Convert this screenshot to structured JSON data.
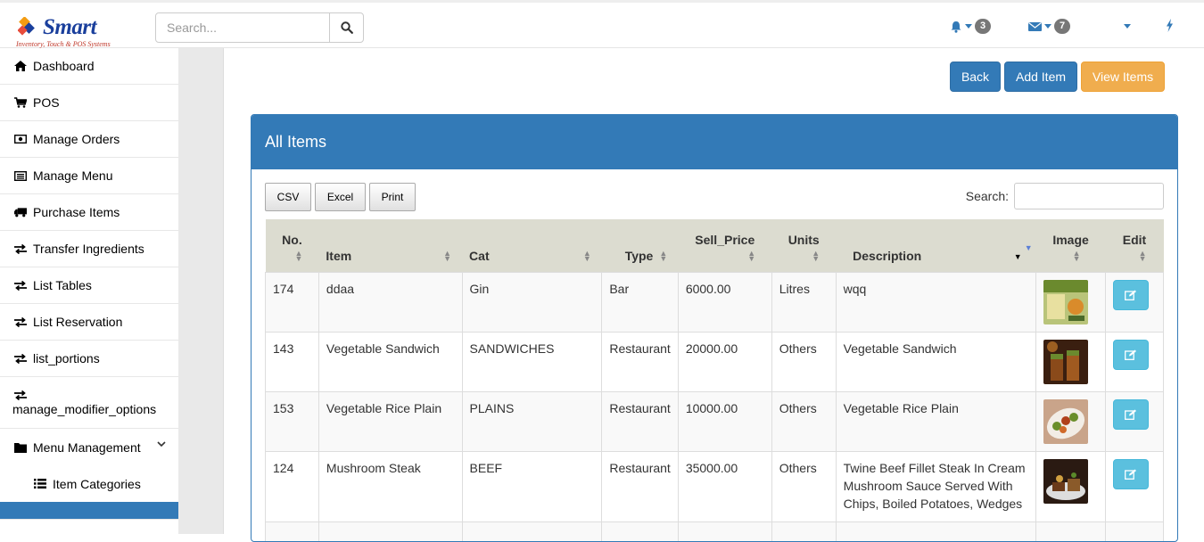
{
  "brand": {
    "name": "Smart",
    "tagline": "Inventory, Touch & POS Systems"
  },
  "header": {
    "search_placeholder": "Search...",
    "notifications_count": "3",
    "messages_count": "7"
  },
  "sidebar": {
    "items": [
      {
        "label": "Dashboard",
        "icon": "home-icon"
      },
      {
        "label": "POS",
        "icon": "cart-icon"
      },
      {
        "label": "Manage Orders",
        "icon": "money-icon"
      },
      {
        "label": "Manage Menu",
        "icon": "list-alt-icon"
      },
      {
        "label": "Purchase Items",
        "icon": "truck-icon"
      },
      {
        "label": "Transfer Ingredients",
        "icon": "exchange-icon"
      },
      {
        "label": "List Tables",
        "icon": "exchange-icon"
      },
      {
        "label": "List Reservation",
        "icon": "exchange-icon"
      },
      {
        "label": "list_portions",
        "icon": "exchange-icon"
      },
      {
        "label": "manage_modifier_options",
        "icon": "exchange-icon"
      },
      {
        "label": "Menu Management",
        "icon": "folder-icon"
      },
      {
        "label": "Item Categories",
        "icon": "list-icon"
      }
    ]
  },
  "actions": {
    "back": "Back",
    "add_item": "Add Item",
    "view_items": "View Items"
  },
  "panel": {
    "title": "All Items",
    "export_buttons": [
      "CSV",
      "Excel",
      "Print"
    ],
    "search_label": "Search:"
  },
  "table": {
    "columns": [
      "No.",
      "Item",
      "Cat",
      "Type",
      "Sell_Price",
      "Units",
      "Description",
      "Image",
      "Edit"
    ],
    "rows": [
      {
        "no": "174",
        "item": "ddaa",
        "cat": "Gin",
        "type": "Bar",
        "price": "6000.00",
        "units": "Litres",
        "description": "wqq"
      },
      {
        "no": "143",
        "item": "Vegetable Sandwich",
        "cat": "SANDWICHES",
        "type": "Restaurant",
        "price": "20000.00",
        "units": "Others",
        "description": "Vegetable Sandwich"
      },
      {
        "no": "153",
        "item": "Vegetable Rice Plain",
        "cat": "PLAINS",
        "type": "Restaurant",
        "price": "10000.00",
        "units": "Others",
        "description": "Vegetable Rice Plain"
      },
      {
        "no": "124",
        "item": "Mushroom Steak",
        "cat": "BEEF",
        "type": "Restaurant",
        "price": "35000.00",
        "units": "Others",
        "description": "Twine Beef Fillet Steak In Cream Mushroom Sauce Served With Chips, Boiled Potatoes, Wedges"
      }
    ]
  },
  "colors": {
    "primary": "#337ab7",
    "warning": "#f0ad4e",
    "info": "#5bc0de",
    "header_bg": "#dcdcd0"
  }
}
